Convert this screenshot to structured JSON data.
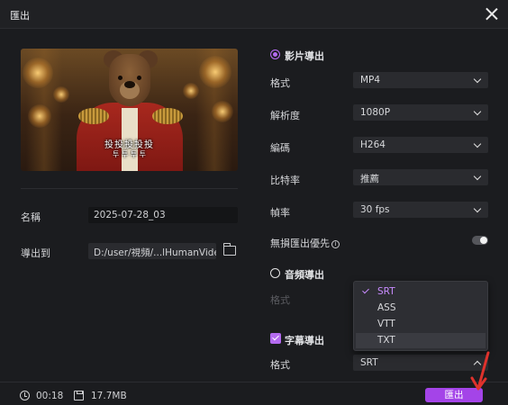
{
  "window": {
    "title": "匯出"
  },
  "video": {
    "caption_line1": "投投投投投",
    "caption_line2": "투 투 투 투",
    "name_label": "名稱",
    "name_value": "2025-07-28_03",
    "path_label": "導出到",
    "path_value": "D:/user/視頻/...lHumanVideo"
  },
  "video_export": {
    "label": "影片導出",
    "format_label": "格式",
    "format_value": "MP4",
    "resolution_label": "解析度",
    "resolution_value": "1080P",
    "codec_label": "編碼",
    "codec_value": "H264",
    "bitrate_label": "比特率",
    "bitrate_value": "推薦",
    "framerate_label": "幀率",
    "framerate_value": "30  fps",
    "lossless_label": "無損匯出優先",
    "lossless_info": "i",
    "lossless_on": false
  },
  "audio_export": {
    "label": "音頻導出",
    "format_label": "格式"
  },
  "subtitle_export": {
    "label": "字幕導出",
    "format_label": "格式",
    "format_value": "SRT",
    "options": [
      "SRT",
      "ASS",
      "VTT",
      "TXT"
    ],
    "selected": "SRT"
  },
  "footer": {
    "duration": "00:18",
    "size": "17.7MB",
    "export_label": "匯出"
  },
  "colors": {
    "accent": "#a444e8",
    "selected_text": "#c88bff",
    "background": "#1b1c1f",
    "arrow": "#e0322c"
  }
}
